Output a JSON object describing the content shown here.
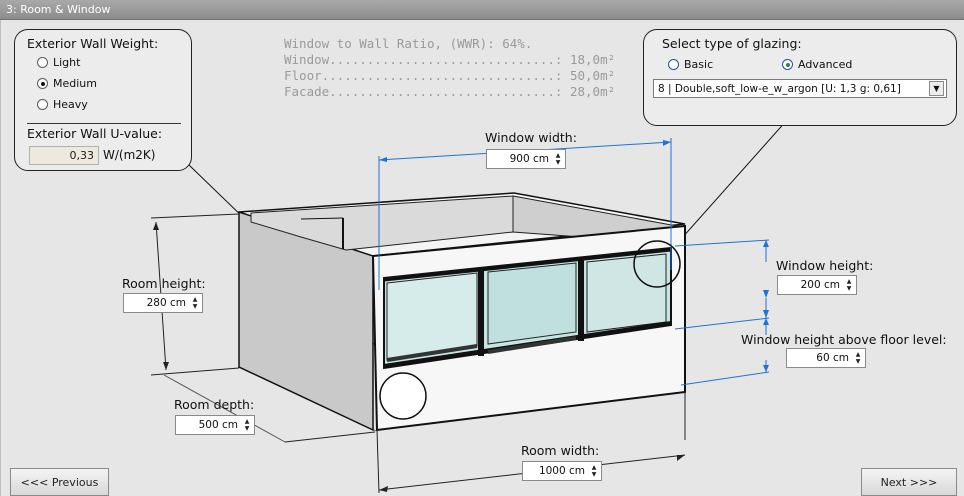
{
  "window": {
    "title": "3: Room & Window"
  },
  "wall_weight": {
    "heading": "Exterior Wall Weight:",
    "options": [
      "Light",
      "Medium",
      "Heavy"
    ],
    "selected": "Medium",
    "u_heading": "Exterior Wall U-value:",
    "u_value": "0,33",
    "u_unit": "W/(m2K)"
  },
  "stats": {
    "wwr": "Window to Wall Ratio, (WWR): 64%.",
    "window": "Window..............................: 18,0m²",
    "floor": "Floor...............................: 50,0m²",
    "facade": "Facade..............................: 28,0m²"
  },
  "glazing": {
    "heading": "Select type of glazing:",
    "options": [
      "Basic",
      "Advanced"
    ],
    "selected": "Advanced",
    "dropdown_value": "8 | Double,soft_low-e_w_argon [U: 1,3 g: 0,61]"
  },
  "dimensions": {
    "window_width": {
      "label": "Window width:",
      "value": "900 cm"
    },
    "room_height": {
      "label": "Room height:",
      "value": "280 cm"
    },
    "window_height": {
      "label": "Window height:",
      "value": "200 cm"
    },
    "window_height_above_floor": {
      "label": "Window height above floor level:",
      "value": "60 cm"
    },
    "room_depth": {
      "label": "Room depth:",
      "value": "500 cm"
    },
    "room_width": {
      "label": "Room width:",
      "value": "1000 cm"
    }
  },
  "nav": {
    "previous": "<<< Previous",
    "next": "Next >>>"
  },
  "colors": {
    "dimension_line": "#1e73d8",
    "window_glass": "#bfe3e0",
    "frame": "#111111"
  }
}
